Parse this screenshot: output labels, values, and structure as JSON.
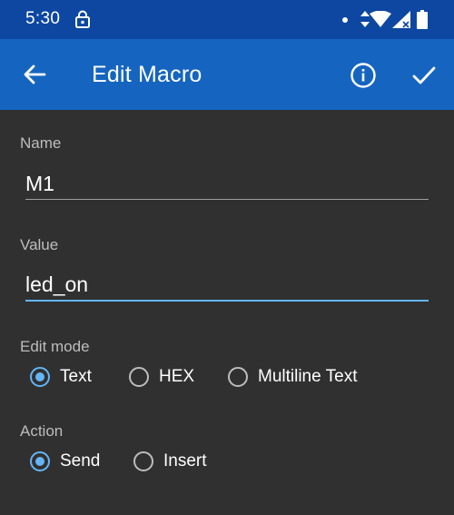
{
  "status_bar": {
    "time": "5:30",
    "icons": [
      "lock-icon",
      "notification-dot",
      "data-arrows-icon",
      "wifi-icon",
      "signal-icon",
      "battery-icon"
    ]
  },
  "app_bar": {
    "title": "Edit Macro",
    "back_icon": "arrow-back-icon",
    "info_icon": "info-icon",
    "confirm_icon": "check-icon"
  },
  "form": {
    "name_label": "Name",
    "name_value": "M1",
    "value_label": "Value",
    "value_value": "led_on",
    "edit_mode_label": "Edit mode",
    "edit_mode_options": [
      {
        "label": "Text",
        "selected": true
      },
      {
        "label": "HEX",
        "selected": false
      },
      {
        "label": "Multiline Text",
        "selected": false
      }
    ],
    "action_label": "Action",
    "action_options": [
      {
        "label": "Send",
        "selected": true
      },
      {
        "label": "Insert",
        "selected": false
      }
    ]
  },
  "colors": {
    "status_bar": "#0d47a1",
    "app_bar": "#1565c0",
    "background": "#303030",
    "accent": "#64b5f6",
    "label": "#bdbdbd"
  }
}
